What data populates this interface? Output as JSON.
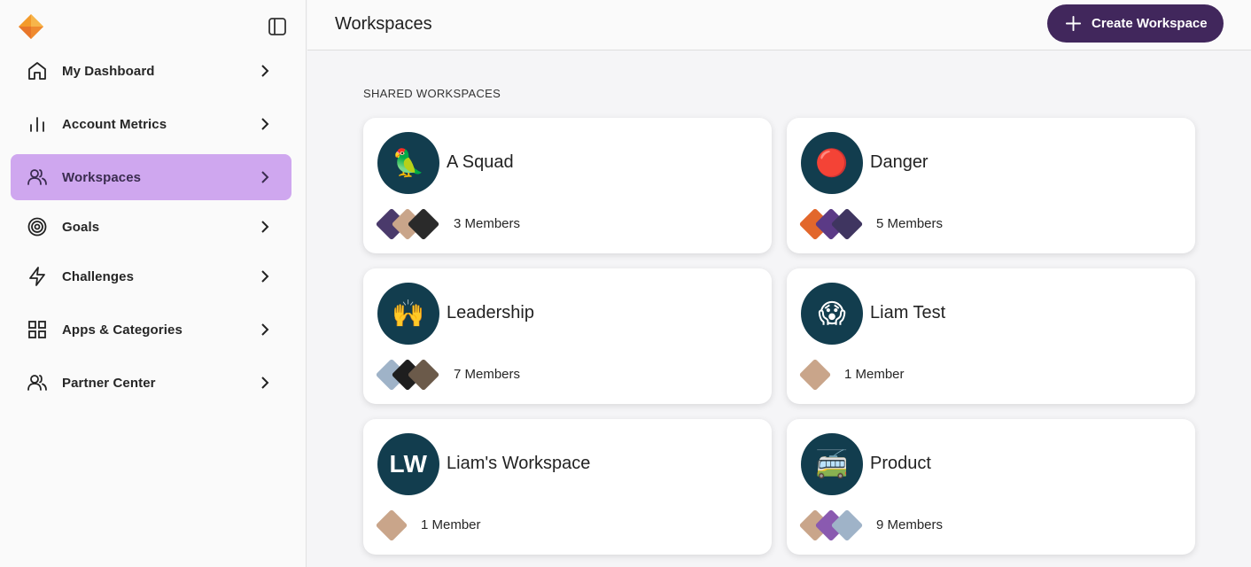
{
  "sidebar": {
    "items": [
      {
        "label": "My Dashboard",
        "icon": "home-icon"
      },
      {
        "label": "Account Metrics",
        "icon": "bar-chart-icon"
      },
      {
        "label": "Workspaces",
        "icon": "users-icon",
        "active": true
      },
      {
        "label": "Goals",
        "icon": "target-icon"
      },
      {
        "label": "Challenges",
        "icon": "lightning-icon"
      },
      {
        "label": "Apps & Categories",
        "icon": "grid-icon"
      },
      {
        "label": "Partner Center",
        "icon": "users-icon"
      }
    ]
  },
  "header": {
    "title": "Workspaces",
    "create_label": "Create Workspace"
  },
  "main": {
    "section_title": "SHARED WORKSPACES",
    "workspaces": [
      {
        "name": "A Squad",
        "avatar": "🦜",
        "members": "3 Members"
      },
      {
        "name": "Danger",
        "avatar": "🔴",
        "members": "5 Members"
      },
      {
        "name": "Leadership",
        "avatar": "🙌",
        "members": "7 Members"
      },
      {
        "name": "Liam Test",
        "avatar": "😱",
        "members": "1 Member"
      },
      {
        "name": "Liam's Workspace",
        "avatar": "LW",
        "members": "1 Member"
      },
      {
        "name": "Product",
        "avatar": "🚎",
        "members": "9 Members"
      }
    ]
  },
  "colors": {
    "accent": "#41275c",
    "active_nav": "#cfa7ef",
    "avatar_bg": "#123d4e"
  }
}
